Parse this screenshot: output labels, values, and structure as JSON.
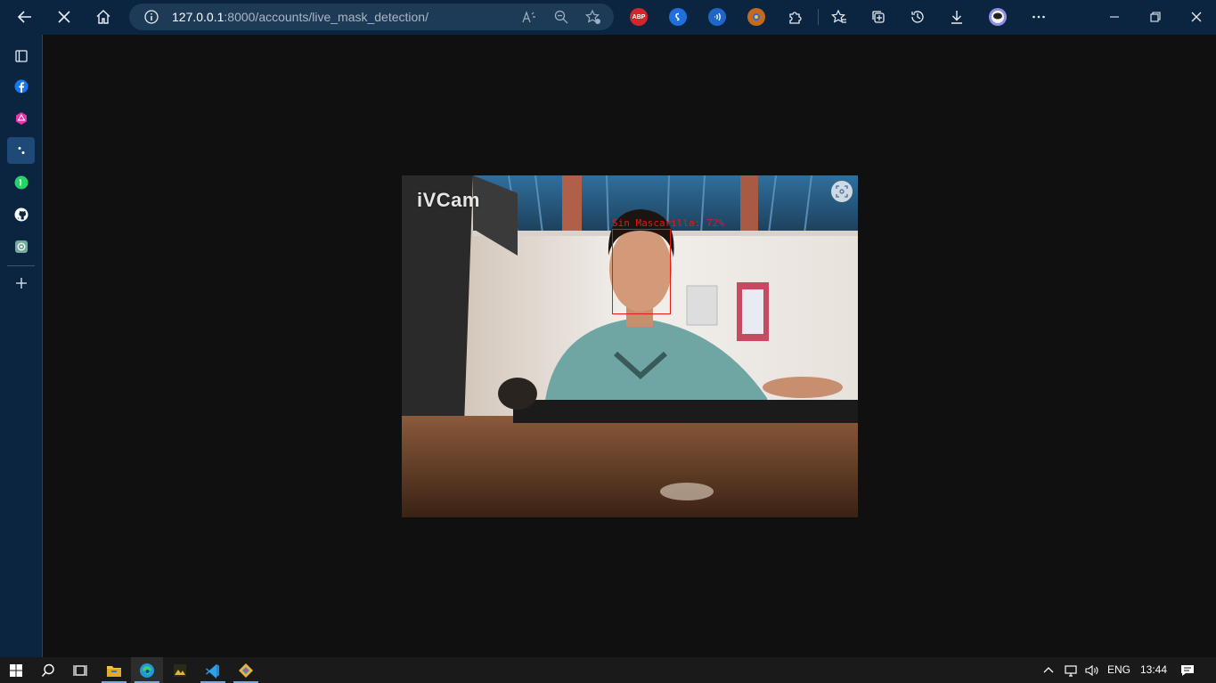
{
  "browser": {
    "url_host": "127.0.0.1",
    "url_rest": ":8000/accounts/live_mask_detection/"
  },
  "extensions": [
    {
      "name": "adblock-plus",
      "label": "ABP",
      "color": "#d4242c"
    },
    {
      "name": "shazam",
      "label": "",
      "color": "#1e6fe0"
    },
    {
      "name": "audio-ext",
      "label": "",
      "color": "#1f66c9"
    },
    {
      "name": "color-ext",
      "label": "",
      "color": "#c56a1c"
    }
  ],
  "camera": {
    "watermark": "iVCam",
    "detection_label": "Sin Mascarilla: 72%"
  },
  "taskbar": {
    "language": "ENG",
    "time": "13:44"
  },
  "colors": {
    "chrome": "#0b2540",
    "detection": "#e21a1a"
  }
}
